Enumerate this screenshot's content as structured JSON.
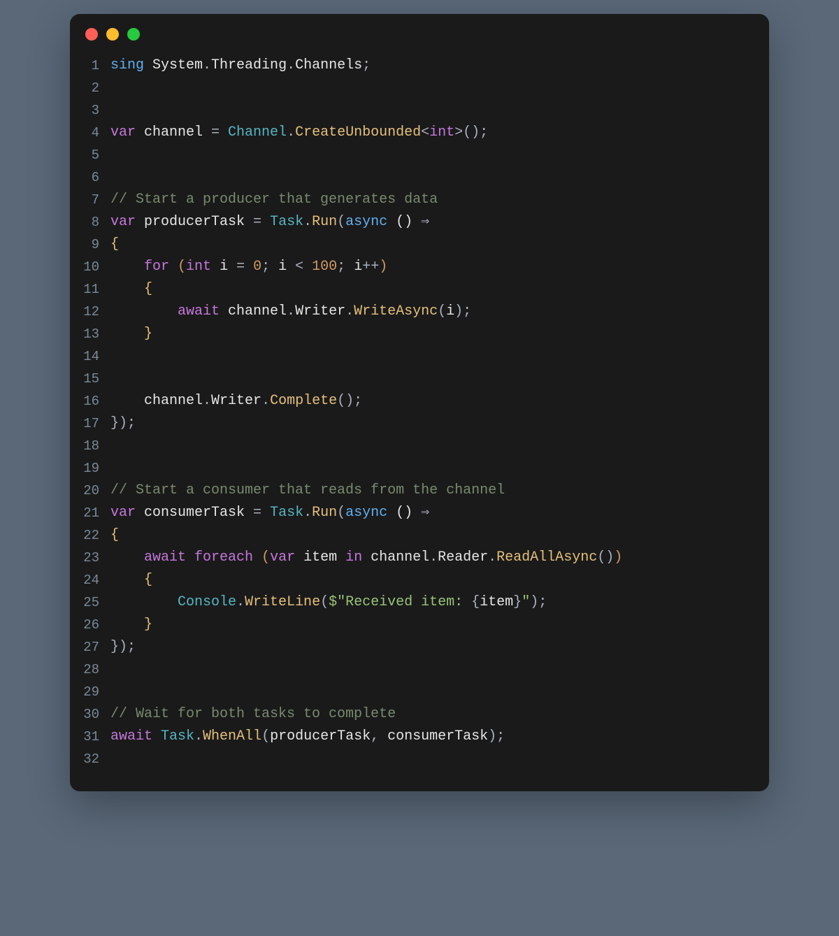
{
  "window": {
    "dots": [
      "red",
      "yellow",
      "green"
    ]
  },
  "code": {
    "lineCount": 32,
    "lines": [
      [
        {
          "t": "sing ",
          "c": "c-blue"
        },
        {
          "t": "System",
          "c": "c-white"
        },
        {
          "t": ".",
          "c": "c-punc"
        },
        {
          "t": "Threading",
          "c": "c-white"
        },
        {
          "t": ".",
          "c": "c-punc"
        },
        {
          "t": "Channels",
          "c": "c-white"
        },
        {
          "t": ";",
          "c": "c-punc"
        }
      ],
      [],
      [],
      [
        {
          "t": "var ",
          "c": "c-kw"
        },
        {
          "t": "channel",
          "c": "c-white"
        },
        {
          "t": " = ",
          "c": "c-op"
        },
        {
          "t": "Channel",
          "c": "c-type"
        },
        {
          "t": ".",
          "c": "c-punc"
        },
        {
          "t": "CreateUnbounded",
          "c": "c-func"
        },
        {
          "t": "<",
          "c": "c-angle"
        },
        {
          "t": "int",
          "c": "c-kw"
        },
        {
          "t": ">",
          "c": "c-angle"
        },
        {
          "t": "();",
          "c": "c-punc"
        }
      ],
      [],
      [],
      [
        {
          "t": "// Start a producer that generates data",
          "c": "c-cmt"
        }
      ],
      [
        {
          "t": "var ",
          "c": "c-kw"
        },
        {
          "t": "producerTask",
          "c": "c-white"
        },
        {
          "t": " = ",
          "c": "c-op"
        },
        {
          "t": "Task",
          "c": "c-type"
        },
        {
          "t": ".",
          "c": "c-punc"
        },
        {
          "t": "Run",
          "c": "c-func"
        },
        {
          "t": "(",
          "c": "c-punc"
        },
        {
          "t": "async",
          "c": "c-blue"
        },
        {
          "t": " () ",
          "c": "c-white"
        },
        {
          "t": "⇒",
          "c": "c-op"
        }
      ],
      [
        {
          "t": "{",
          "c": "c-brace"
        }
      ],
      [
        {
          "t": "    ",
          "c": ""
        },
        {
          "t": "for ",
          "c": "c-kw"
        },
        {
          "t": "(",
          "c": "c-paren"
        },
        {
          "t": "int ",
          "c": "c-kw"
        },
        {
          "t": "i",
          "c": "c-white"
        },
        {
          "t": " = ",
          "c": "c-op"
        },
        {
          "t": "0",
          "c": "c-num"
        },
        {
          "t": "; ",
          "c": "c-punc"
        },
        {
          "t": "i",
          "c": "c-white"
        },
        {
          "t": " < ",
          "c": "c-op"
        },
        {
          "t": "100",
          "c": "c-num"
        },
        {
          "t": "; ",
          "c": "c-punc"
        },
        {
          "t": "i",
          "c": "c-white"
        },
        {
          "t": "++",
          "c": "c-op"
        },
        {
          "t": ")",
          "c": "c-paren"
        }
      ],
      [
        {
          "t": "    {",
          "c": "c-brace"
        }
      ],
      [
        {
          "t": "        ",
          "c": ""
        },
        {
          "t": "await ",
          "c": "c-kw"
        },
        {
          "t": "channel",
          "c": "c-white"
        },
        {
          "t": ".",
          "c": "c-punc"
        },
        {
          "t": "Writer",
          "c": "c-white"
        },
        {
          "t": ".",
          "c": "c-punc"
        },
        {
          "t": "WriteAsync",
          "c": "c-func"
        },
        {
          "t": "(",
          "c": "c-punc"
        },
        {
          "t": "i",
          "c": "c-white"
        },
        {
          "t": ");",
          "c": "c-punc"
        }
      ],
      [
        {
          "t": "    }",
          "c": "c-brace"
        }
      ],
      [],
      [],
      [
        {
          "t": "    ",
          "c": ""
        },
        {
          "t": "channel",
          "c": "c-white"
        },
        {
          "t": ".",
          "c": "c-punc"
        },
        {
          "t": "Writer",
          "c": "c-white"
        },
        {
          "t": ".",
          "c": "c-punc"
        },
        {
          "t": "Complete",
          "c": "c-func"
        },
        {
          "t": "();",
          "c": "c-punc"
        }
      ],
      [
        {
          "t": "});",
          "c": "c-punc"
        }
      ],
      [],
      [],
      [
        {
          "t": "// Start a consumer that reads from the channel",
          "c": "c-cmt"
        }
      ],
      [
        {
          "t": "var ",
          "c": "c-kw"
        },
        {
          "t": "consumerTask",
          "c": "c-white"
        },
        {
          "t": " = ",
          "c": "c-op"
        },
        {
          "t": "Task",
          "c": "c-type"
        },
        {
          "t": ".",
          "c": "c-punc"
        },
        {
          "t": "Run",
          "c": "c-func"
        },
        {
          "t": "(",
          "c": "c-punc"
        },
        {
          "t": "async",
          "c": "c-blue"
        },
        {
          "t": " () ",
          "c": "c-white"
        },
        {
          "t": "⇒",
          "c": "c-op"
        }
      ],
      [
        {
          "t": "{",
          "c": "c-brace"
        }
      ],
      [
        {
          "t": "    ",
          "c": ""
        },
        {
          "t": "await ",
          "c": "c-kw"
        },
        {
          "t": "foreach ",
          "c": "c-kw"
        },
        {
          "t": "(",
          "c": "c-paren"
        },
        {
          "t": "var ",
          "c": "c-kw"
        },
        {
          "t": "item",
          "c": "c-white"
        },
        {
          "t": " in ",
          "c": "c-kw"
        },
        {
          "t": "channel",
          "c": "c-white"
        },
        {
          "t": ".",
          "c": "c-punc"
        },
        {
          "t": "Reader",
          "c": "c-white"
        },
        {
          "t": ".",
          "c": "c-punc"
        },
        {
          "t": "ReadAllAsync",
          "c": "c-func"
        },
        {
          "t": "()",
          "c": "c-punc"
        },
        {
          "t": ")",
          "c": "c-paren"
        }
      ],
      [
        {
          "t": "    {",
          "c": "c-brace"
        }
      ],
      [
        {
          "t": "        ",
          "c": ""
        },
        {
          "t": "Console",
          "c": "c-type"
        },
        {
          "t": ".",
          "c": "c-punc"
        },
        {
          "t": "WriteLine",
          "c": "c-func"
        },
        {
          "t": "(",
          "c": "c-punc"
        },
        {
          "t": "$\"",
          "c": "c-str"
        },
        {
          "t": "Received item: ",
          "c": "c-str"
        },
        {
          "t": "{",
          "c": "c-punc"
        },
        {
          "t": "item",
          "c": "c-white"
        },
        {
          "t": "}",
          "c": "c-punc"
        },
        {
          "t": "\"",
          "c": "c-str"
        },
        {
          "t": ");",
          "c": "c-punc"
        }
      ],
      [
        {
          "t": "    }",
          "c": "c-brace"
        }
      ],
      [
        {
          "t": "});",
          "c": "c-punc"
        }
      ],
      [],
      [],
      [
        {
          "t": "// Wait for both tasks to complete",
          "c": "c-cmt"
        }
      ],
      [
        {
          "t": "await ",
          "c": "c-kw"
        },
        {
          "t": "Task",
          "c": "c-type"
        },
        {
          "t": ".",
          "c": "c-punc"
        },
        {
          "t": "WhenAll",
          "c": "c-func"
        },
        {
          "t": "(",
          "c": "c-punc"
        },
        {
          "t": "producerTask",
          "c": "c-white"
        },
        {
          "t": ", ",
          "c": "c-punc"
        },
        {
          "t": "consumerTask",
          "c": "c-white"
        },
        {
          "t": ");",
          "c": "c-punc"
        }
      ],
      []
    ]
  }
}
